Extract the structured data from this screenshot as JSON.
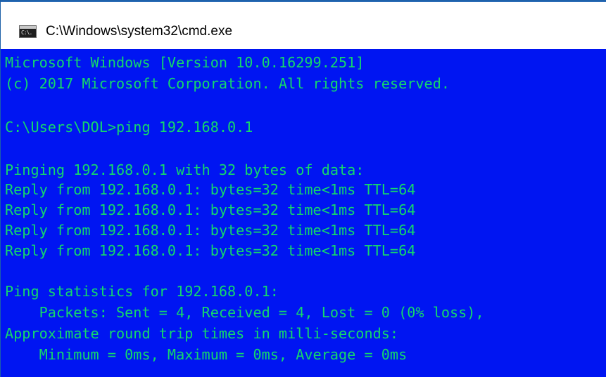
{
  "window": {
    "title": "C:\\Windows\\system32\\cmd.exe",
    "icon": "cmd-icon",
    "icon_glyph": "C:\\."
  },
  "colors": {
    "console_background": "#0015f2",
    "console_text": "#13d86b",
    "titlebar_background": "#ffffff",
    "title_text": "#000000"
  },
  "console": {
    "lines": [
      "Microsoft Windows [Version 10.0.16299.251]",
      "(c) 2017 Microsoft Corporation. All rights reserved.",
      "",
      "C:\\Users\\DOL>ping 192.168.0.1",
      "",
      "Pinging 192.168.0.1 with 32 bytes of data:",
      "Reply from 192.168.0.1: bytes=32 time<1ms TTL=64",
      "Reply from 192.168.0.1: bytes=32 time<1ms TTL=64",
      "Reply from 192.168.0.1: bytes=32 time<1ms TTL=64",
      "Reply from 192.168.0.1: bytes=32 time<1ms TTL=64",
      "",
      "Ping statistics for 192.168.0.1:",
      "    Packets: Sent = 4, Received = 4, Lost = 0 (0% loss),",
      "Approximate round trip times in milli-seconds:",
      "    Minimum = 0ms, Maximum = 0ms, Average = 0ms"
    ]
  }
}
